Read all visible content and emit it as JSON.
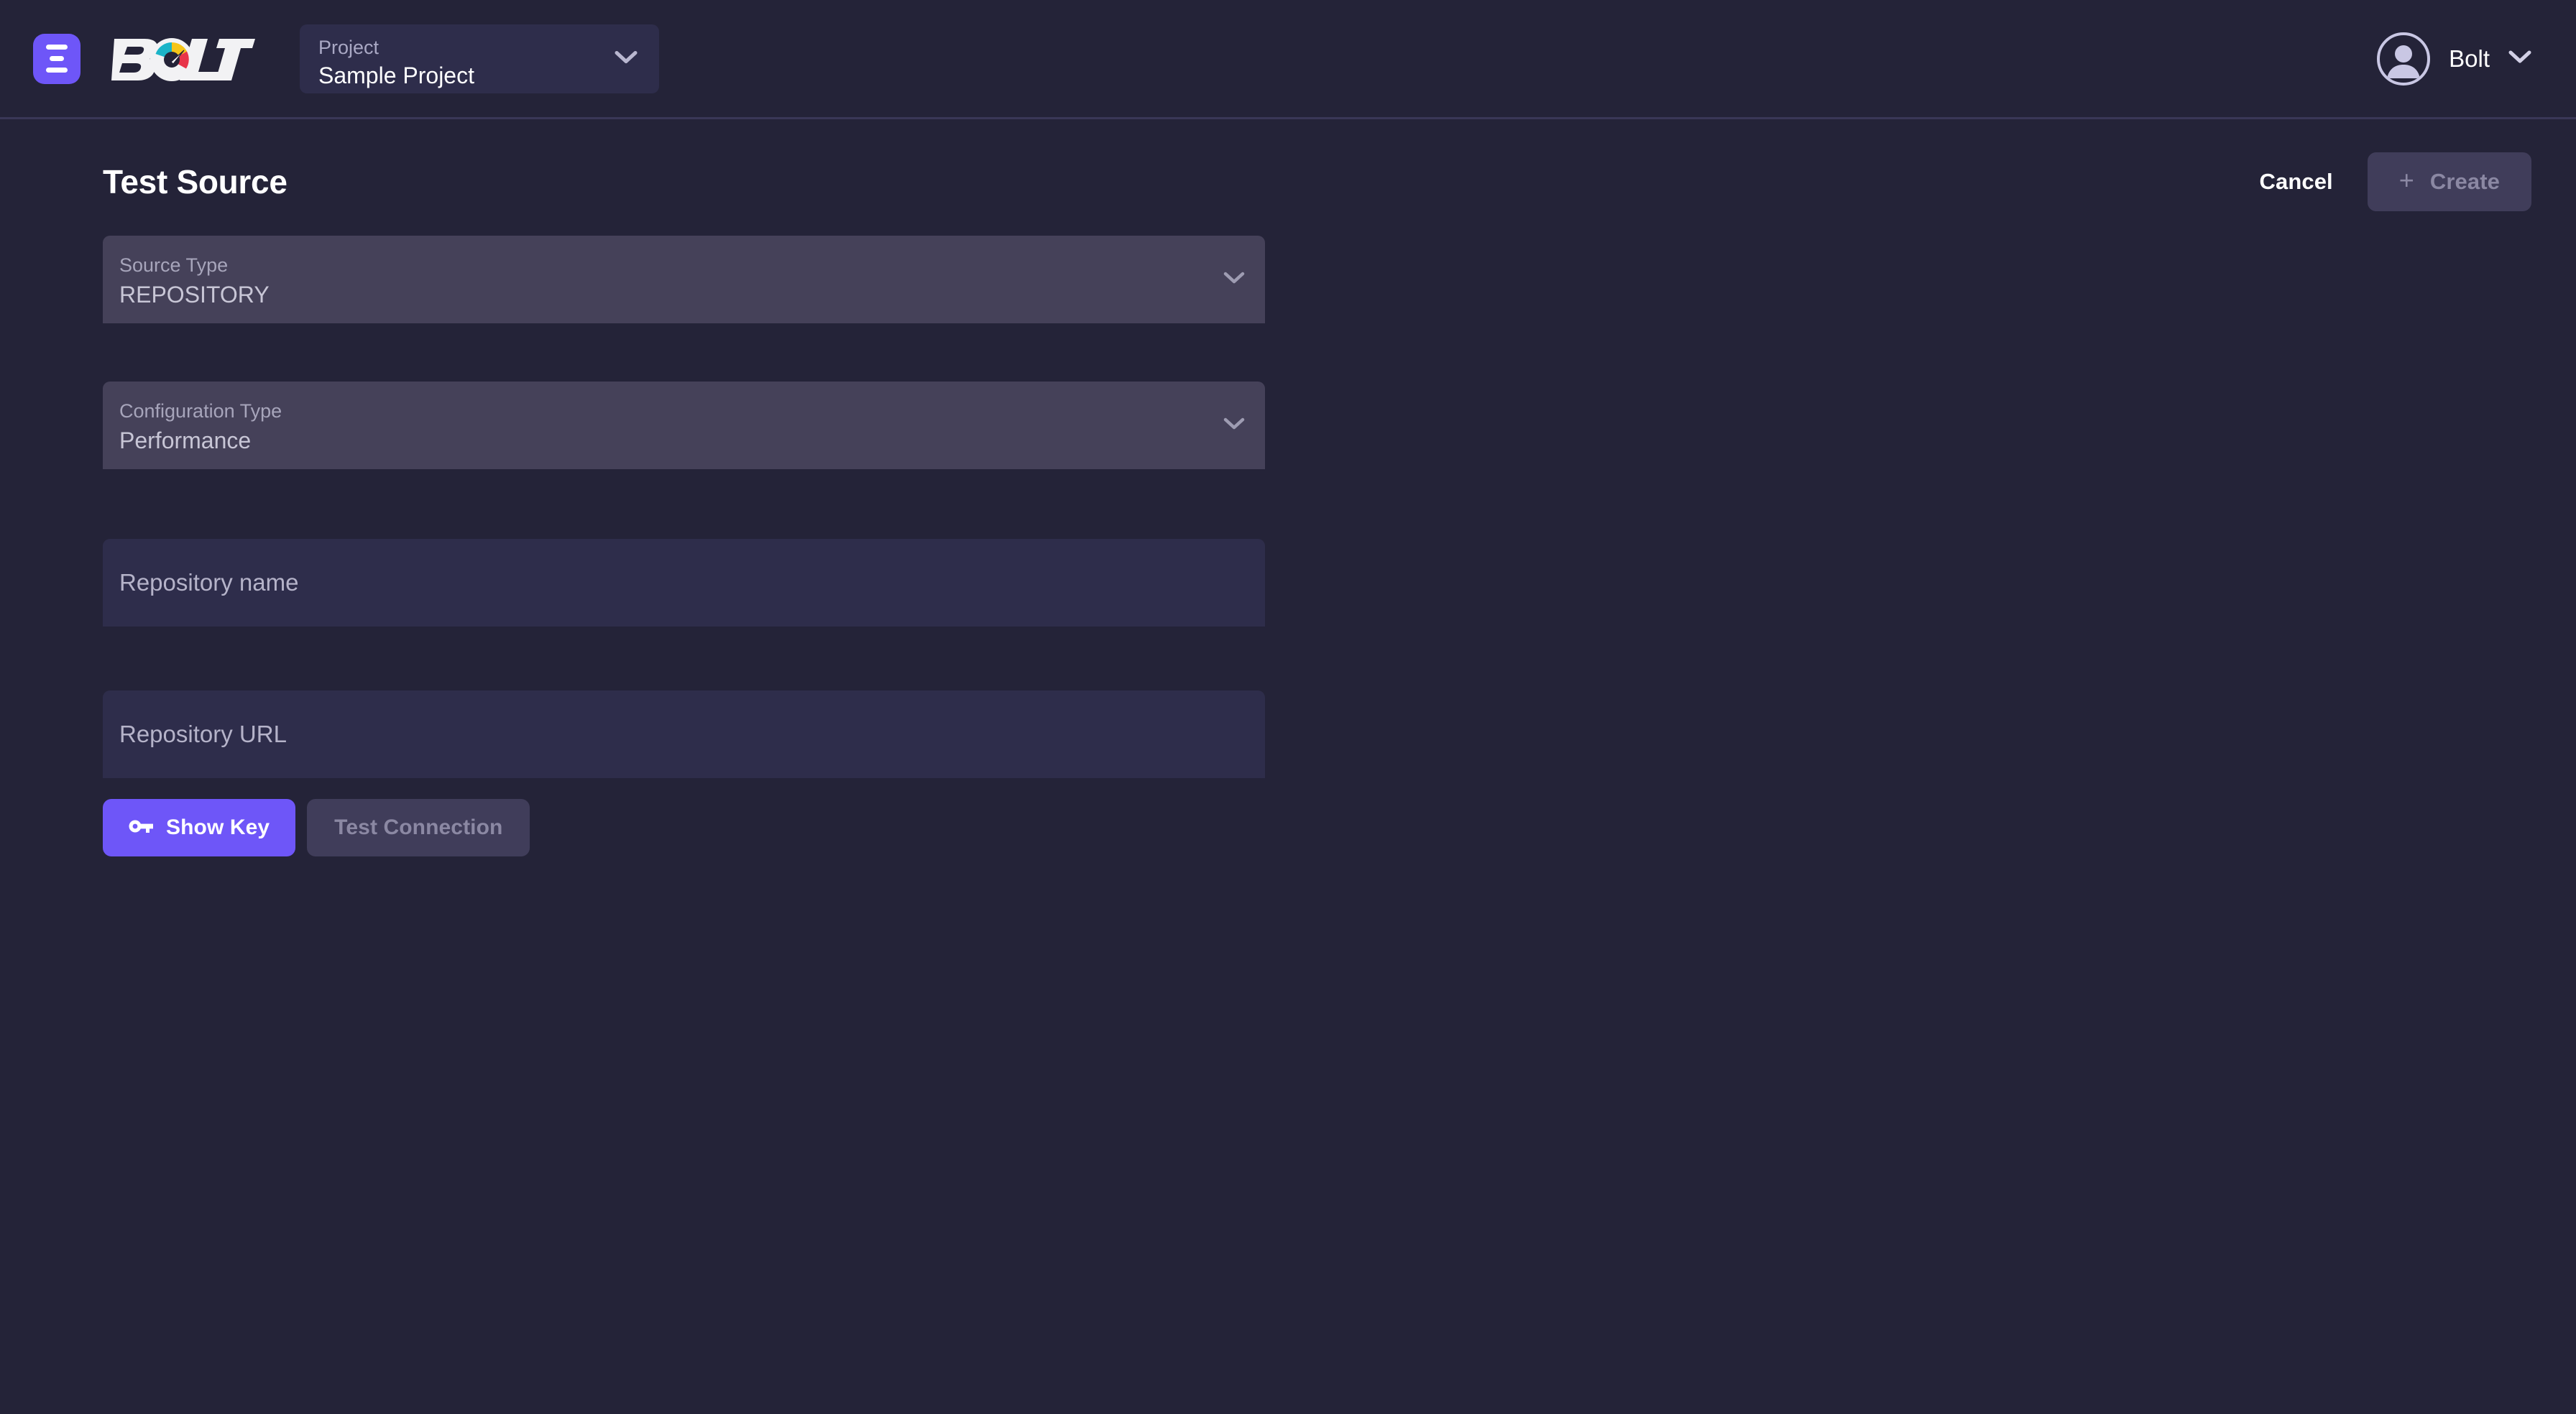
{
  "header": {
    "menu_icon": "hamburger-menu-icon",
    "brand": {
      "text_before": "B",
      "text_after": "LT",
      "gauge_icon": "speedometer-gauge-icon"
    },
    "project_selector": {
      "label": "Project",
      "value": "Sample Project",
      "chevron_icon": "chevron-down-icon"
    },
    "user": {
      "name": "Bolt",
      "avatar_icon": "user-avatar-icon",
      "chevron_icon": "chevron-down-icon"
    }
  },
  "page": {
    "title": "Test Source",
    "actions": {
      "cancel_label": "Cancel",
      "create_label": "Create",
      "create_icon": "plus-icon",
      "create_disabled": true
    }
  },
  "form": {
    "source_type": {
      "label": "Source Type",
      "value": "REPOSITORY",
      "chevron_icon": "chevron-down-icon"
    },
    "configuration_type": {
      "label": "Configuration Type",
      "value": "Performance",
      "chevron_icon": "chevron-down-icon"
    },
    "repository_name": {
      "placeholder": "Repository name",
      "value": ""
    },
    "repository_url": {
      "placeholder": "Repository URL",
      "value": ""
    },
    "buttons": {
      "show_key_label": "Show Key",
      "show_key_icon": "key-icon",
      "test_connection_label": "Test Connection",
      "test_connection_disabled": true
    }
  },
  "colors": {
    "page_background": "#242338",
    "surface_input": "#2e2d4b",
    "surface_select": "#454159",
    "accent_purple": "#6e56f8",
    "disabled_button": "#403d5a",
    "disabled_text": "#8b88a3",
    "muted_text": "#a9a8c4",
    "gauge_teal": "#1bb4c8",
    "gauge_yellow": "#f5c518",
    "gauge_red": "#e8354a"
  }
}
